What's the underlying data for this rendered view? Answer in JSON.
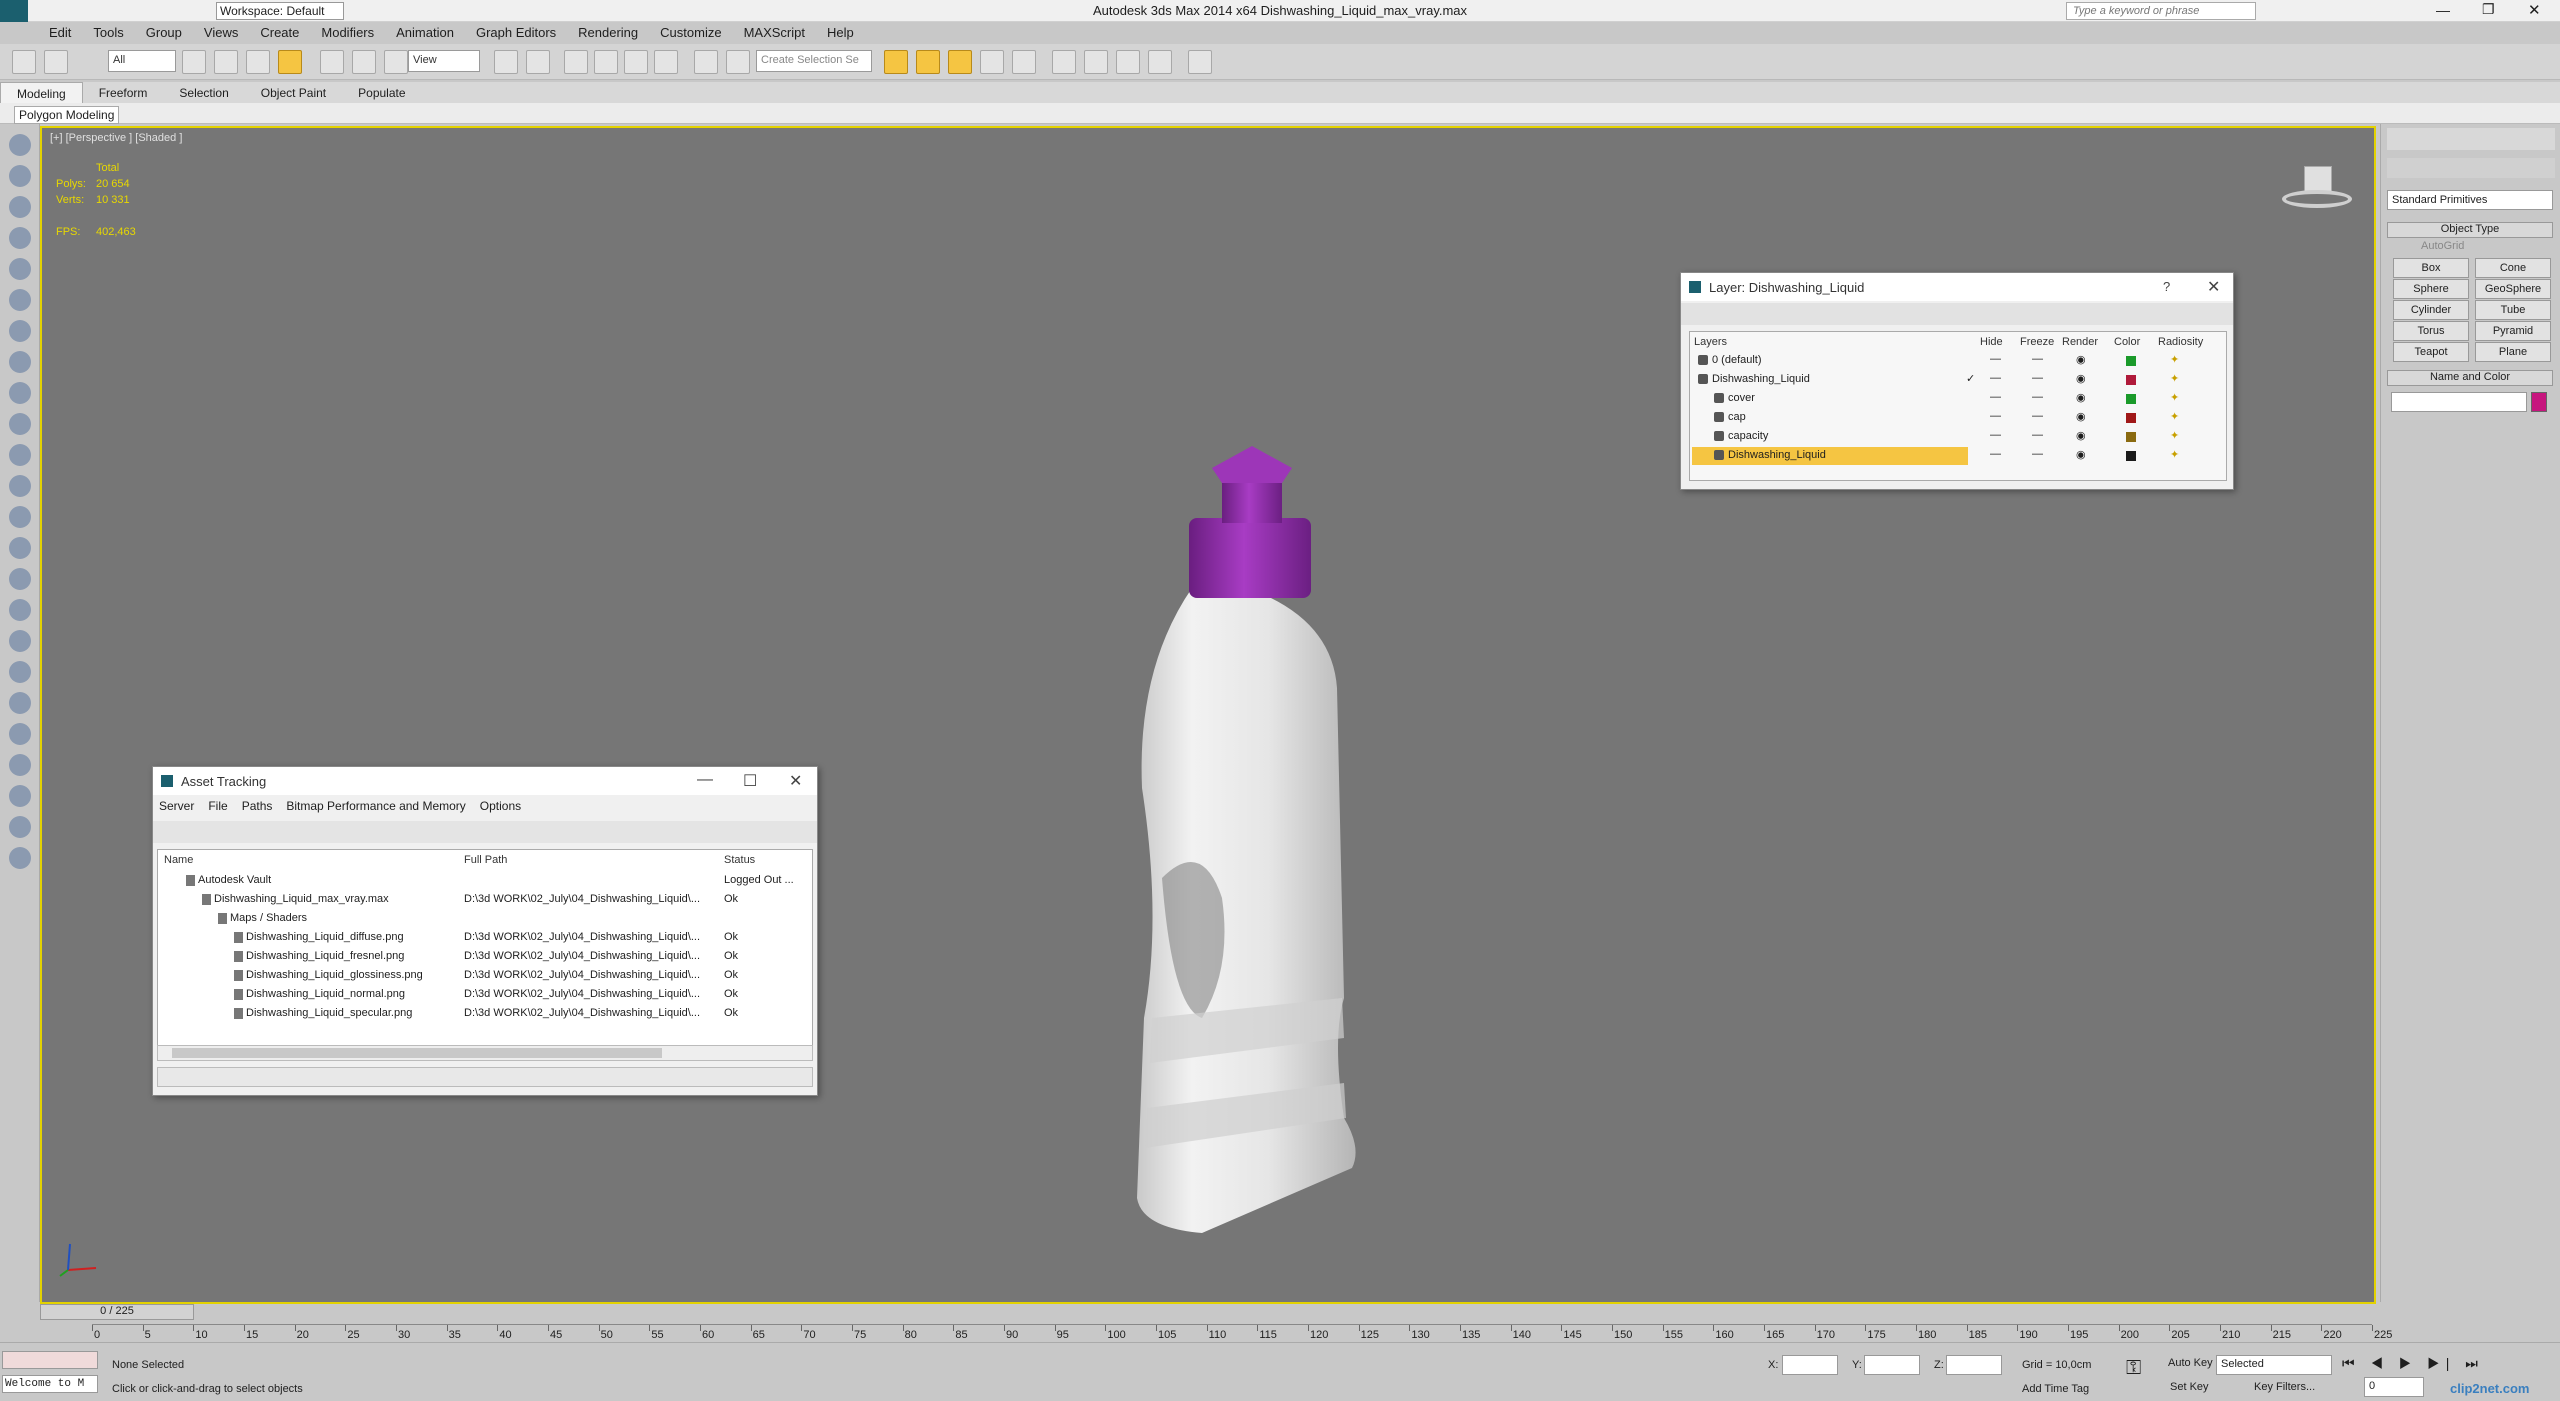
{
  "app": {
    "title": "Autodesk 3ds Max  2014 x64    Dishwashing_Liquid_max_vray.max",
    "workspace": "Workspace: Default",
    "search_placeholder": "Type a keyword or phrase"
  },
  "menu": [
    "Edit",
    "Tools",
    "Group",
    "Views",
    "Create",
    "Modifiers",
    "Animation",
    "Graph Editors",
    "Rendering",
    "Customize",
    "MAXScript",
    "Help"
  ],
  "toolbar": {
    "filter": "All",
    "view": "View",
    "selection_set": "Create Selection Se"
  },
  "ribbon": {
    "tabs": [
      "Modeling",
      "Freeform",
      "Selection",
      "Object Paint",
      "Populate"
    ],
    "sub": "Polygon Modeling"
  },
  "viewport": {
    "label": "[+] [Perspective ] [Shaded ]",
    "total": "Total",
    "polys_label": "Polys:",
    "polys": "20 654",
    "verts_label": "Verts:",
    "verts": "10 331",
    "fps_label": "FPS:",
    "fps": "402,463"
  },
  "layer_window": {
    "title": "Layer: Dishwashing_Liquid",
    "help": "?",
    "headers": [
      "Layers",
      "Hide",
      "Freeze",
      "Render",
      "Color",
      "Radiosity"
    ],
    "rows": [
      {
        "name": "0 (default)",
        "color": "#1a9a2a",
        "check": ""
      },
      {
        "name": "Dishwashing_Liquid",
        "color": "#b01a3a",
        "check": "✓"
      },
      {
        "name": "cover",
        "color": "#1a9a2a",
        "check": ""
      },
      {
        "name": "cap",
        "color": "#a01818",
        "check": ""
      },
      {
        "name": "capacity",
        "color": "#8a6a10",
        "check": ""
      },
      {
        "name": "Dishwashing_Liquid",
        "color": "#1a1a1a",
        "check": ""
      }
    ]
  },
  "asset_window": {
    "title": "Asset Tracking",
    "menu": [
      "Server",
      "File",
      "Paths",
      "Bitmap Performance and Memory",
      "Options"
    ],
    "headers": [
      "Name",
      "Full Path",
      "Status"
    ],
    "rows": [
      {
        "name": "Autodesk Vault",
        "path": "",
        "status": "Logged Out ..."
      },
      {
        "name": "Dishwashing_Liquid_max_vray.max",
        "path": "D:\\3d WORK\\02_July\\04_Dishwashing_Liquid\\...",
        "status": "Ok"
      },
      {
        "name": "Maps / Shaders",
        "path": "",
        "status": ""
      },
      {
        "name": "Dishwashing_Liquid_diffuse.png",
        "path": "D:\\3d WORK\\02_July\\04_Dishwashing_Liquid\\...",
        "status": "Ok"
      },
      {
        "name": "Dishwashing_Liquid_fresnel.png",
        "path": "D:\\3d WORK\\02_July\\04_Dishwashing_Liquid\\...",
        "status": "Ok"
      },
      {
        "name": "Dishwashing_Liquid_glossiness.png",
        "path": "D:\\3d WORK\\02_July\\04_Dishwashing_Liquid\\...",
        "status": "Ok"
      },
      {
        "name": "Dishwashing_Liquid_normal.png",
        "path": "D:\\3d WORK\\02_July\\04_Dishwashing_Liquid\\...",
        "status": "Ok"
      },
      {
        "name": "Dishwashing_Liquid_specular.png",
        "path": "D:\\3d WORK\\02_July\\04_Dishwashing_Liquid\\...",
        "status": "Ok"
      }
    ]
  },
  "command_panel": {
    "dropdown": "Standard Primitives",
    "object_type": "Object Type",
    "autogrid": "AutoGrid",
    "buttons": [
      "Box",
      "Cone",
      "Sphere",
      "GeoSphere",
      "Cylinder",
      "Tube",
      "Torus",
      "Pyramid",
      "Teapot",
      "Plane"
    ],
    "name_color": "Name and Color"
  },
  "timeline": {
    "frame": "0 / 225",
    "ticks": [
      "0",
      "5",
      "10",
      "15",
      "20",
      "25",
      "30",
      "35",
      "40",
      "45",
      "50",
      "55",
      "60",
      "65",
      "70",
      "75",
      "80",
      "85",
      "90",
      "95",
      "100",
      "105",
      "110",
      "115",
      "120",
      "125",
      "130",
      "135",
      "140",
      "145",
      "150",
      "155",
      "160",
      "165",
      "170",
      "175",
      "180",
      "185",
      "190",
      "195",
      "200",
      "205",
      "210",
      "215",
      "220",
      "225"
    ]
  },
  "status": {
    "welcome": "Welcome to M",
    "selection": "None Selected",
    "prompt": "Click or click-and-drag to select objects",
    "x": "X:",
    "y": "Y:",
    "z": "Z:",
    "grid": "Grid = 10,0cm",
    "auto_key": "Auto Key",
    "selected": "Selected",
    "set_key": "Set Key",
    "key_filters": "Key Filters...",
    "add_time_tag": "Add Time Tag",
    "frame_value": "0",
    "watermark": "clip2net.com"
  },
  "colors": {
    "cap": "#8a2ca0",
    "viewport_border": "#e3d200",
    "highlight": "#f5c542"
  }
}
